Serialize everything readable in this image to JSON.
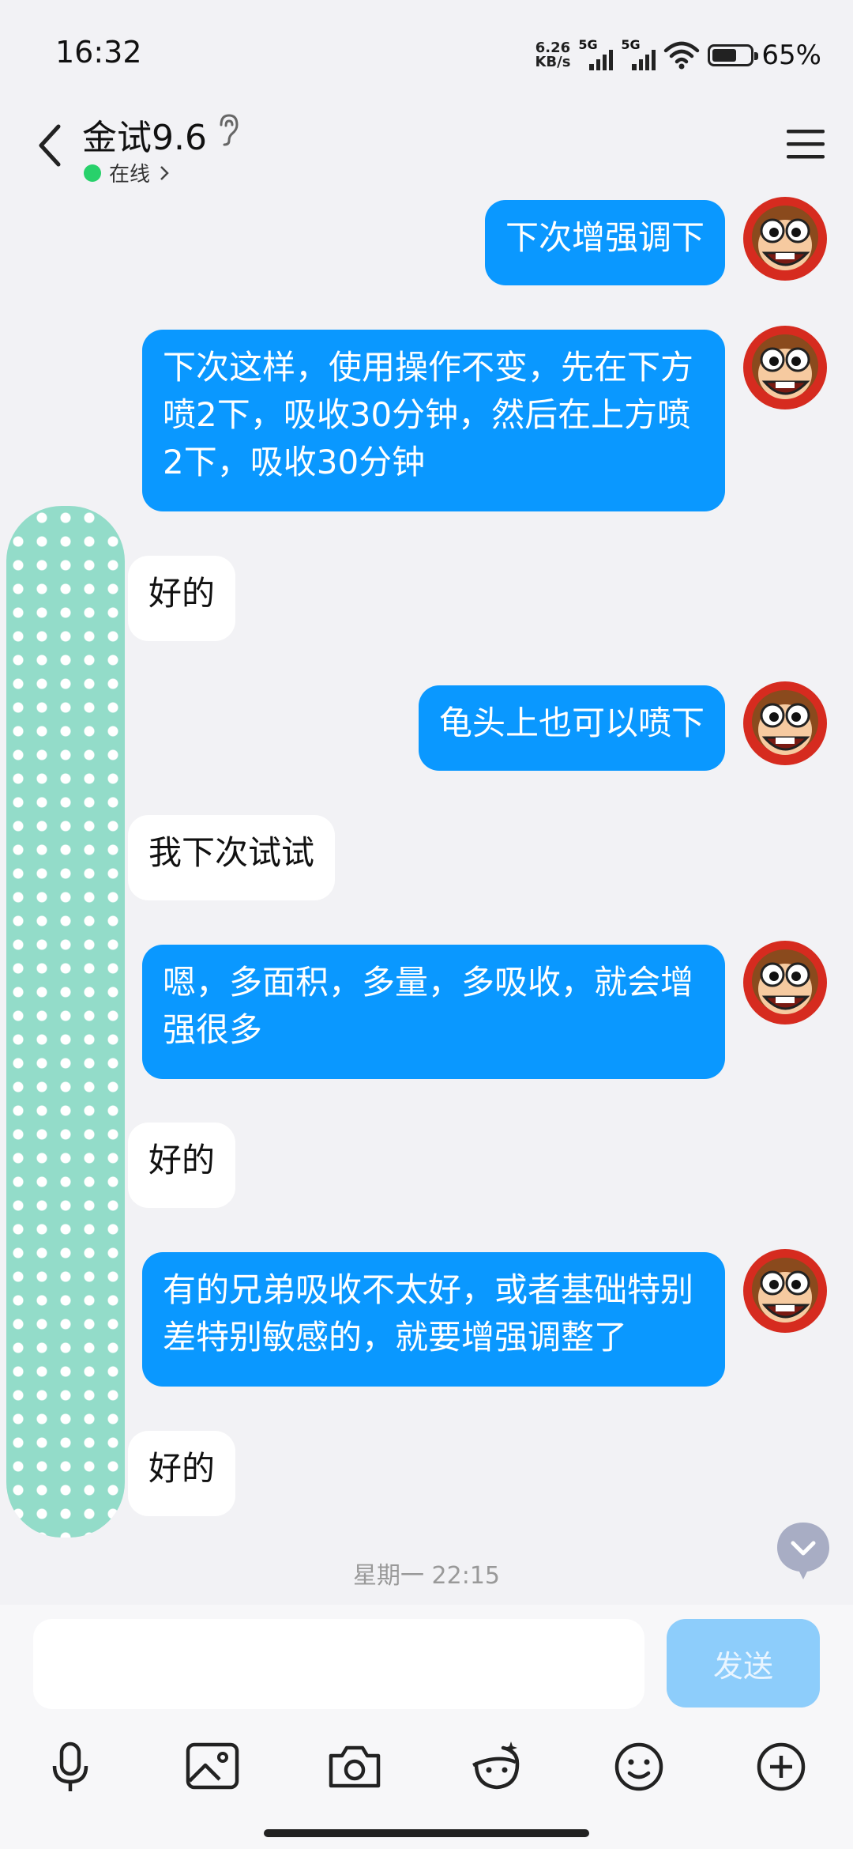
{
  "status_bar": {
    "time": "16:32",
    "net_speed_value": "6.26",
    "net_speed_unit": "KB/s",
    "signal1_label": "5G",
    "signal2_label": "5G",
    "battery_percent": "65%",
    "battery_level": 0.65
  },
  "header": {
    "title": "金试9.6",
    "status": "在线"
  },
  "messages": [
    {
      "side": "sent",
      "text": "下次增强调下"
    },
    {
      "side": "sent",
      "text": "下次这样，使用操作不变，先在下方喷2下，吸收30分钟，然后在上方喷2下，吸收30分钟"
    },
    {
      "side": "received",
      "text": "好的"
    },
    {
      "side": "sent",
      "text": "龟头上也可以喷下"
    },
    {
      "side": "received",
      "text": "我下次试试"
    },
    {
      "side": "sent",
      "text": "嗯，多面积，多量，多吸收，就会增强很多"
    },
    {
      "side": "received",
      "text": "好的"
    },
    {
      "side": "sent",
      "text": "有的兄弟吸收不太好，或者基础特别差特别敏感的，就要增强调整了"
    },
    {
      "side": "received",
      "text": "好的"
    }
  ],
  "timestamp": "星期一 22:15",
  "composer": {
    "placeholder": "",
    "send_label": "发送"
  },
  "toolbar_icons": [
    "microphone-icon",
    "image-icon",
    "camera-icon",
    "magic-face-icon",
    "emoji-icon",
    "plus-icon"
  ],
  "colors": {
    "sent_bubble": "#0a98ff",
    "received_bubble": "#ffffff",
    "online_dot": "#28d16b",
    "send_button": "#8dcdfb",
    "privacy_mask": "#93dcc9"
  }
}
